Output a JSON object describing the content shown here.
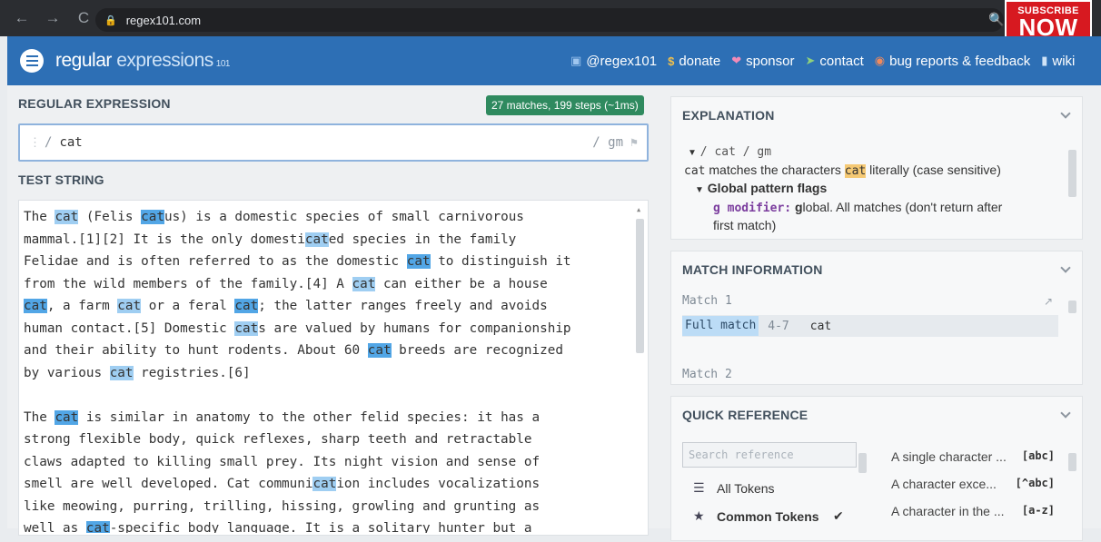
{
  "browser": {
    "url": "regex101.com",
    "back_icon": "←",
    "forward_icon": "→",
    "reload_icon": "C"
  },
  "overlay": {
    "subscribe_line1": "SUBSCRIBE",
    "subscribe_line2": "NOW"
  },
  "header": {
    "logo_main": "regular",
    "logo_sub": "expressions",
    "logo_version": "101",
    "links": [
      {
        "label": "@regex101",
        "icon": "twitter-icon"
      },
      {
        "label": "donate",
        "icon": "dollar-icon"
      },
      {
        "label": "sponsor",
        "icon": "heart-icon"
      },
      {
        "label": "contact",
        "icon": "paper-plane-icon"
      },
      {
        "label": "bug reports & feedback",
        "icon": "bug-icon"
      },
      {
        "label": "wiki",
        "icon": "book-icon"
      }
    ]
  },
  "regex": {
    "section_title": "REGULAR EXPRESSION",
    "match_summary": "27 matches, 199 steps (~1ms)",
    "delimiter_open": "/",
    "value": "cat",
    "flags": "/ gm"
  },
  "test_string": {
    "section_title": "TEST STRING"
  },
  "explanation": {
    "title": "EXPLANATION",
    "tree_root": "/ cat / gm",
    "line1_code": "cat",
    "line1_a": "matches the characters",
    "line1_hl": "cat",
    "line1_b": "literally (case sensitive)",
    "flags_heading": "Global pattern flags",
    "g_modifier_label": "g modifier:",
    "g_modifier_first": "g",
    "g_modifier_rest": "lobal. All matches (don't return after",
    "g_modifier_line2": "first match)"
  },
  "match_info": {
    "title": "MATCH INFORMATION",
    "match1_label": "Match 1",
    "full_match_label": "Full match",
    "full_match_pos": "4-7",
    "full_match_value": "cat",
    "match2_label": "Match 2"
  },
  "quick_ref": {
    "title": "QUICK REFERENCE",
    "search_placeholder": "Search reference",
    "categories": [
      {
        "label": "All Tokens",
        "icon": "database-icon"
      },
      {
        "label": "Common Tokens",
        "icon": "star-icon"
      }
    ],
    "items": [
      {
        "label": "A single character ...",
        "token": "[abc]"
      },
      {
        "label": "A character exce...",
        "token": "[^abc]"
      },
      {
        "label": "A character in the ...",
        "token": "[a-z]"
      }
    ]
  }
}
